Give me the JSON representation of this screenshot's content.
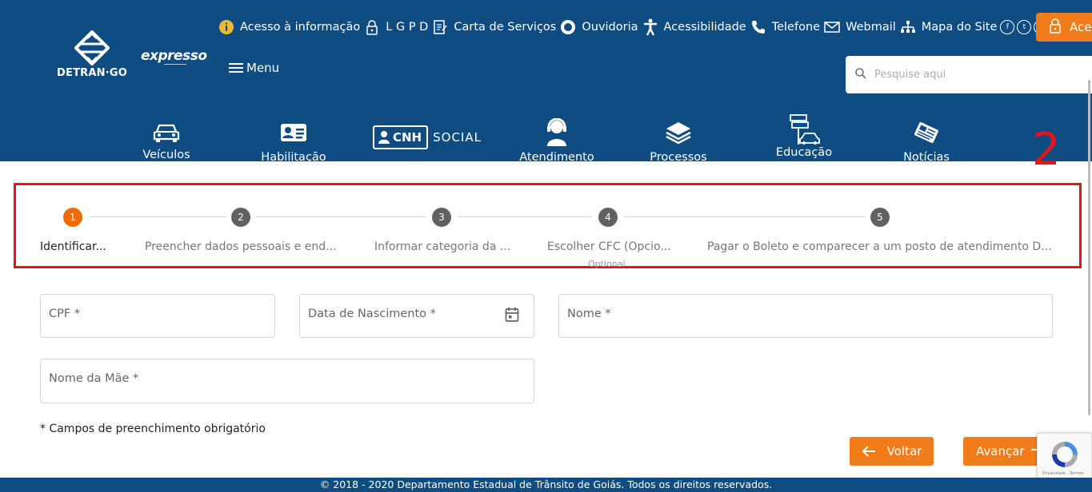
{
  "brand": {
    "logo_text": "DETRAN·GO",
    "expresso_text": "expresso"
  },
  "topbar": {
    "items": [
      {
        "label": "Acesso à informação",
        "icon": "info-icon"
      },
      {
        "label": "L G P D",
        "icon": "lock-icon"
      },
      {
        "label": "Carta de Serviços",
        "icon": "document-icon"
      },
      {
        "label": "Ouvidoria",
        "icon": "ouvidoria-icon"
      },
      {
        "label": "Acessibilidade",
        "icon": "accessibility-icon"
      },
      {
        "label": "Telefone",
        "icon": "phone-icon"
      },
      {
        "label": "Webmail",
        "icon": "mail-icon"
      },
      {
        "label": "Mapa do Site",
        "icon": "sitemap-icon"
      }
    ],
    "social": [
      "facebook-icon",
      "twitter-icon",
      "youtube-icon",
      "instagram-icon"
    ],
    "access_button": "Acesso"
  },
  "menu": {
    "label": "Menu"
  },
  "search": {
    "placeholder": "Pesquise aqui"
  },
  "nav": {
    "items": [
      {
        "label": "Veículos",
        "icon": "car-icon"
      },
      {
        "label": "Habilitação",
        "icon": "id-card-icon"
      },
      {
        "label": "Atendimento",
        "icon": "attendant-icon"
      },
      {
        "label": "Processos",
        "icon": "layers-icon"
      },
      {
        "label": "Educação",
        "icon": "education-icon"
      },
      {
        "label": "Notícias",
        "icon": "news-icon"
      }
    ],
    "cnh_social": {
      "cnh": "CNH",
      "social": "SOCIAL"
    }
  },
  "annotation": {
    "number": "2",
    "color": "#e8121a"
  },
  "stepper": {
    "steps": [
      {
        "number": "1",
        "label": "Identificar...",
        "active": true
      },
      {
        "number": "2",
        "label": "Preencher dados pessoais e end...",
        "active": false
      },
      {
        "number": "3",
        "label": "Informar categoria da ...",
        "active": false
      },
      {
        "number": "4",
        "label": "Escolher CFC (Opcio...",
        "active": false,
        "optional": "Optional"
      },
      {
        "number": "5",
        "label": "Pagar o Boleto e comparecer a um posto de atendimento D...",
        "active": false
      }
    ]
  },
  "form": {
    "cpf_label": "CPF *",
    "birth_label": "Data de Nascimento *",
    "name_label": "Nome *",
    "mother_label": "Nome da Mãe *",
    "required_note": "* Campos de preenchimento obrigatório"
  },
  "buttons": {
    "back": "Voltar",
    "next": "Avançar"
  },
  "recaptcha": {
    "text": "Privacidade - Termos"
  },
  "footer": {
    "text": "© 2018 - 2020 Departamento Estadual de Trânsito de Goiás. Todos os direitos reservados."
  },
  "colors": {
    "header_bg": "#0f4c81",
    "accent": "#f07d1a",
    "active_step": "#ef6c00",
    "annotation": "#e8121a"
  }
}
